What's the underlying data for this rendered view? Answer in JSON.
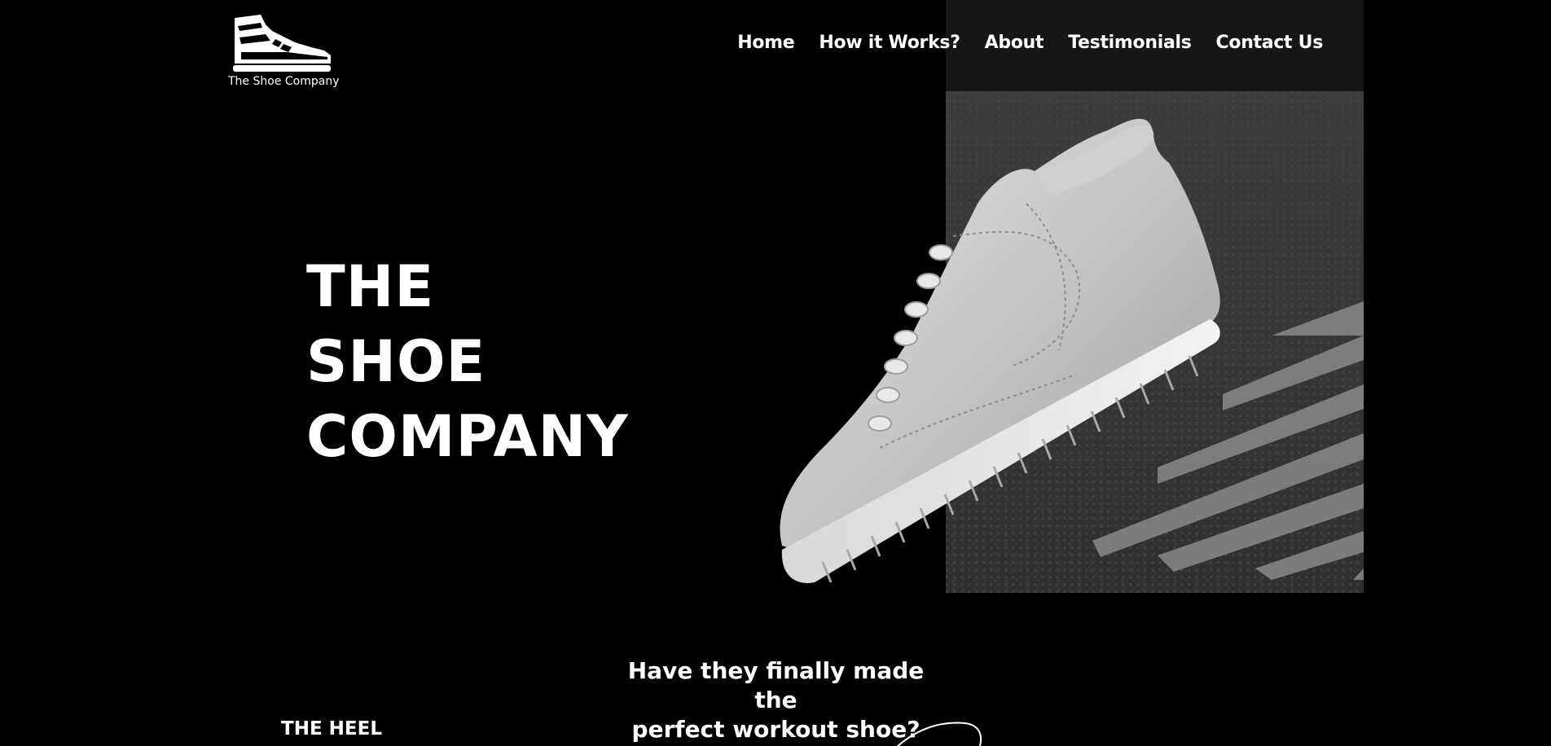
{
  "brand": {
    "logo_icon": "sneaker-logo-icon",
    "name": "The Shoe Company"
  },
  "nav": {
    "items": [
      {
        "label": "Home"
      },
      {
        "label": "How it Works?"
      },
      {
        "label": "About"
      },
      {
        "label": "Testimonials"
      },
      {
        "label": "Contact Us"
      }
    ]
  },
  "hero": {
    "title_lines": [
      "THE",
      "SHOE",
      "COMPANY"
    ],
    "image": "white-sneaker-on-asphalt-crosswalk"
  },
  "intro": {
    "tagline_line1": "Have they finally made the",
    "tagline_line2": "perfect workout shoe?",
    "section_label": "THE HEEL"
  },
  "colors": {
    "background": "#000000",
    "text": "#ffffff"
  }
}
